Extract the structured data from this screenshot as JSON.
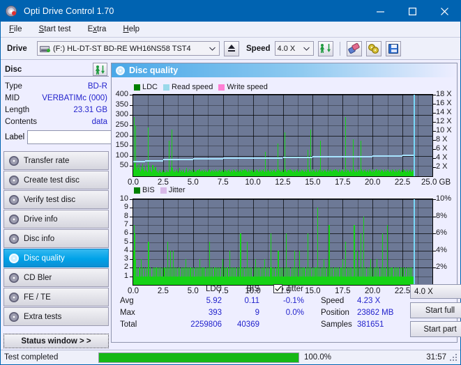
{
  "window": {
    "title": "Opti Drive Control 1.70",
    "icon": "disc-icon",
    "minimize": "minimize-icon",
    "maximize": "maximize-icon",
    "close": "close-icon"
  },
  "menu": {
    "items": [
      "File",
      "Start test",
      "Extra",
      "Help"
    ]
  },
  "toolbar": {
    "drive_label": "Drive",
    "drive_value": "(F:)  HL-DT-ST BD-RE  WH16NS58 TST4",
    "eject_icon": "eject-icon",
    "speed_label": "Speed",
    "speed_value": "4.0 X",
    "refresh_icon": "scan-refresh-icon",
    "erase_icon": "erase-icon",
    "discs_icon": "discs-icon",
    "save_icon": "save-icon"
  },
  "disc_panel": {
    "header": "Disc",
    "refresh_icon": "scan-refresh-icon",
    "rows": [
      {
        "key": "Type",
        "value": "BD-R"
      },
      {
        "key": "MID",
        "value": "VERBATIMc (000)"
      },
      {
        "key": "Length",
        "value": "23.31 GB"
      },
      {
        "key": "Contents",
        "value": "data"
      }
    ],
    "label_key": "Label",
    "label_value": "",
    "label_button_icon": "disc-icon"
  },
  "nav": {
    "items": [
      {
        "label": "Transfer rate",
        "icon": "disc-icon",
        "active": false
      },
      {
        "label": "Create test disc",
        "icon": "disc-icon",
        "active": false
      },
      {
        "label": "Verify test disc",
        "icon": "disc-icon",
        "active": false
      },
      {
        "label": "Drive info",
        "icon": "disc-icon",
        "active": false
      },
      {
        "label": "Disc info",
        "icon": "disc-icon",
        "active": false
      },
      {
        "label": "Disc quality",
        "icon": "disc-icon",
        "active": true
      },
      {
        "label": "CD Bler",
        "icon": "disc-icon",
        "active": false
      },
      {
        "label": "FE / TE",
        "icon": "disc-icon",
        "active": false
      },
      {
        "label": "Extra tests",
        "icon": "disc-icon",
        "active": false
      }
    ],
    "status_window": "Status window > >"
  },
  "content": {
    "header": "Disc quality",
    "header_icon": "disc-icon"
  },
  "stats": {
    "col_ldc": "LDC",
    "col_bis": "BIS",
    "rows": [
      {
        "key": "Avg",
        "ldc": "5.92",
        "bis": "0.11"
      },
      {
        "key": "Max",
        "ldc": "393",
        "bis": "9"
      },
      {
        "key": "Total",
        "ldc": "2259806",
        "bis": "40369"
      }
    ],
    "jitter_label": "Jitter",
    "jitter_checked": true,
    "jitter_values": [
      "-0.1%",
      "0.0%"
    ],
    "speed_key": "Speed",
    "speed_value": "4.23 X",
    "position_key": "Position",
    "position_value": "23862 MB",
    "samples_key": "Samples",
    "samples_value": "381651",
    "speed_select": "4.0 X",
    "start_full": "Start full",
    "start_part": "Start part"
  },
  "statusbar": {
    "text": "Test completed",
    "progress_label": "100.0%",
    "progress_value": 100,
    "time": "31:57"
  },
  "chart_data": [
    {
      "type": "bar",
      "name": "ldc-chart",
      "title": "",
      "xlabel": "GB",
      "ylabel": "",
      "ylim": [
        0,
        400
      ],
      "yticks": [
        50,
        100,
        150,
        200,
        250,
        300,
        350,
        400
      ],
      "y2lim": [
        0,
        18
      ],
      "y2ticks": [
        "2 X",
        "4 X",
        "6 X",
        "8 X",
        "10 X",
        "12 X",
        "14 X",
        "16 X",
        "18 X"
      ],
      "xlim": [
        0,
        25
      ],
      "xticks": [
        "0.0",
        "2.5",
        "5.0",
        "7.5",
        "10.0",
        "12.5",
        "15.0",
        "17.5",
        "20.0",
        "22.5",
        "25.0 GB"
      ],
      "grid": true,
      "legend": [
        {
          "label": "LDC",
          "color": "#008000"
        },
        {
          "label": "Read speed",
          "color": "#99d9ea"
        },
        {
          "label": "Write speed",
          "color": "#ff7fd4"
        }
      ],
      "series": [
        {
          "name": "LDC",
          "color": "#16d216",
          "values": [
            35,
            290,
            60,
            250,
            45,
            30,
            55,
            40,
            60,
            30,
            25,
            48,
            35,
            60,
            42,
            30,
            24,
            52,
            30,
            26,
            22,
            240,
            55,
            30,
            46,
            28,
            20,
            55,
            34,
            24,
            30,
            44,
            26,
            22,
            30,
            18,
            26,
            34,
            22,
            18,
            24,
            30,
            20,
            26,
            18,
            22,
            30,
            20,
            26,
            22,
            175,
            30,
            24,
            44,
            230,
            40,
            26,
            22,
            30,
            20,
            26,
            34,
            24,
            18,
            26,
            40,
            22,
            30,
            26,
            20,
            34,
            26,
            18,
            22,
            30,
            40,
            24,
            18,
            26,
            34,
            22,
            30,
            26,
            20,
            34,
            22,
            30,
            26,
            20,
            24,
            30,
            22,
            26,
            34,
            20,
            24,
            30,
            26,
            22,
            34,
            26,
            20,
            30,
            24,
            22,
            26,
            30,
            34,
            20,
            24,
            30,
            26,
            22,
            30,
            26,
            22,
            34,
            24,
            28,
            22,
            30,
            26,
            34,
            20,
            24,
            30,
            26,
            22,
            34,
            24,
            30,
            26,
            22,
            30,
            26,
            34,
            24,
            20,
            30,
            26,
            22,
            34,
            26,
            30,
            24,
            20,
            34,
            26,
            22,
            30,
            24,
            26,
            34,
            20,
            30,
            26,
            22,
            34,
            26,
            30,
            24,
            20,
            34,
            26,
            22,
            30,
            26,
            34,
            24,
            20,
            30,
            26,
            22,
            34,
            26,
            30,
            24,
            20,
            34,
            26,
            22,
            30,
            26,
            34,
            24,
            20,
            120,
            26,
            22,
            34,
            26,
            30,
            24,
            20,
            34,
            26,
            22,
            30,
            26,
            34,
            24,
            20,
            30,
            26,
            160,
            34,
            26,
            30,
            24,
            20,
            34,
            26,
            22,
            30,
            215,
            34,
            24,
            20,
            30,
            26,
            22,
            34,
            26,
            30,
            24,
            20,
            34,
            26,
            22,
            30,
            26,
            34,
            24,
            20,
            30,
            26,
            22,
            34,
            26,
            30,
            24,
            20,
            34,
            26,
            22,
            30,
            130,
            34,
            24,
            20,
            230,
            26,
            22,
            34,
            26,
            30,
            24,
            20,
            34,
            26,
            22,
            30,
            26,
            34,
            175,
            20,
            30,
            26,
            22,
            34,
            26,
            30,
            24,
            20,
            34,
            26,
            22,
            30,
            26,
            34,
            24,
            20,
            30,
            26,
            22,
            34,
            26,
            30,
            24,
            20,
            34,
            26,
            22,
            30,
            26,
            34,
            24,
            20,
            30,
            290,
            22,
            34,
            26,
            30,
            24,
            20,
            34,
            26,
            22,
            30,
            180,
            34,
            24,
            20,
            30,
            26,
            22,
            34,
            26,
            30,
            24,
            175,
            34,
            26,
            22,
            30,
            26,
            34,
            24,
            20,
            30,
            26,
            22,
            34,
            26,
            30,
            24,
            20,
            34,
            26,
            22,
            30,
            26,
            34,
            24,
            20,
            30,
            26,
            22,
            34,
            26,
            30,
            24,
            20,
            34,
            26,
            22,
            30,
            26,
            34,
            24,
            20,
            30,
            26,
            22,
            34,
            26,
            30,
            24,
            20,
            34,
            26,
            22,
            30,
            26,
            34,
            24,
            20,
            30,
            26,
            22,
            34,
            26,
            30,
            24,
            20,
            34,
            26,
            22,
            30,
            26,
            34,
            24,
            20,
            30,
            26,
            22
          ]
        },
        {
          "name": "Read speed",
          "color": "#a8e4ff",
          "points": [
            [
              0.0,
              3.4
            ],
            [
              1.0,
              3.6
            ],
            [
              2.5,
              3.8
            ],
            [
              5.0,
              4.0
            ],
            [
              7.5,
              4.1
            ],
            [
              10.0,
              4.2
            ],
            [
              12.5,
              4.3
            ],
            [
              15.0,
              4.4
            ],
            [
              17.5,
              4.5
            ],
            [
              20.0,
              4.6
            ],
            [
              22.5,
              4.7
            ],
            [
              23.4,
              4.8
            ]
          ]
        }
      ],
      "cursor_x": 23.4
    },
    {
      "type": "bar",
      "name": "bis-chart",
      "title": "",
      "xlabel": "GB",
      "ylabel": "",
      "ylim": [
        0,
        10
      ],
      "yticks": [
        1,
        2,
        3,
        4,
        5,
        6,
        7,
        8,
        9,
        10
      ],
      "y2lim": [
        0,
        10
      ],
      "y2ticks": [
        "2%",
        "4%",
        "6%",
        "8%",
        "10%"
      ],
      "xlim": [
        0,
        25
      ],
      "xticks": [
        "0.0",
        "2.5",
        "5.0",
        "7.5",
        "10.0",
        "12.5",
        "15.0",
        "17.5",
        "20.0",
        "22.5",
        "25.0 GB"
      ],
      "grid": true,
      "legend": [
        {
          "label": "BIS",
          "color": "#008000"
        },
        {
          "label": "Jitter",
          "color": "#d8b8e8"
        }
      ],
      "series": [
        {
          "name": "BIS",
          "color": "#16d216",
          "values": [
            4,
            7,
            6,
            3,
            1,
            2,
            1,
            1,
            2,
            1,
            3,
            1,
            2,
            1,
            1,
            2,
            1,
            1,
            2,
            1,
            5,
            5,
            1,
            2,
            1,
            1,
            2,
            1,
            2,
            1,
            2,
            2,
            1,
            2,
            1,
            2,
            1,
            2,
            1,
            1,
            2,
            1,
            2,
            1,
            2,
            1,
            5,
            1,
            2,
            1,
            4,
            1,
            2,
            1,
            4,
            1,
            2,
            1,
            2,
            1,
            2,
            1,
            2,
            1,
            1,
            2,
            1,
            2,
            1,
            2,
            1,
            3,
            1,
            2,
            1,
            2,
            1,
            2,
            1,
            2,
            1,
            2,
            1,
            1,
            2,
            1,
            2,
            1,
            2,
            1,
            3,
            1,
            2,
            1,
            2,
            1,
            2,
            1,
            1,
            2,
            1,
            2,
            1,
            5,
            1,
            2,
            1,
            2,
            1,
            1,
            2,
            1,
            2,
            1,
            2,
            1,
            2,
            1,
            1,
            2,
            1,
            3,
            1,
            2,
            1,
            2,
            1,
            2,
            1,
            1,
            4,
            1,
            2,
            1,
            2,
            1,
            2,
            1,
            2,
            1,
            1,
            2,
            1,
            2,
            1,
            6,
            1,
            2,
            1,
            2,
            1,
            1,
            2,
            1,
            5,
            1,
            2,
            1,
            2,
            1,
            2,
            1,
            1,
            2,
            1,
            3,
            1,
            2,
            1,
            2,
            1,
            2,
            1,
            1,
            2,
            1,
            2,
            1,
            3,
            1,
            2,
            1,
            2,
            1,
            1,
            2,
            6,
            2,
            1,
            2,
            1,
            2,
            1,
            1,
            2,
            1,
            4,
            1,
            2,
            1,
            2,
            1,
            2,
            1,
            1,
            2,
            1,
            6,
            1,
            2,
            1,
            2,
            1,
            1,
            2,
            1,
            2,
            1,
            4,
            1,
            2,
            1,
            2,
            1,
            1,
            4,
            1,
            2,
            1,
            2,
            1,
            2,
            1,
            1,
            2,
            1,
            6,
            1,
            2,
            1,
            2,
            1,
            1,
            2,
            1,
            2,
            1,
            2,
            1,
            9,
            1,
            2,
            1,
            1,
            2,
            1,
            2,
            1,
            3,
            1,
            2,
            1,
            1,
            2,
            1,
            7,
            1,
            2,
            1,
            2,
            1,
            1,
            2,
            1,
            2,
            1,
            2,
            1,
            2,
            1,
            1,
            2,
            1,
            3,
            1,
            2,
            1,
            5,
            1,
            1,
            2,
            1,
            2,
            1,
            2,
            1,
            2,
            1,
            1,
            7,
            1,
            2,
            1,
            4,
            1,
            2,
            1,
            1,
            6,
            1,
            2,
            1,
            8,
            1,
            2,
            1,
            1,
            2,
            1,
            2,
            1,
            3,
            1,
            2,
            1,
            1,
            2,
            1,
            2,
            1,
            3,
            1,
            2,
            1,
            1,
            2,
            1,
            6,
            1,
            2,
            1,
            2,
            1,
            1,
            7,
            1,
            2,
            1,
            2,
            1,
            2,
            1,
            1,
            2,
            1,
            2,
            1,
            2,
            1,
            2,
            1,
            1,
            2,
            1,
            2,
            1,
            2,
            1,
            2,
            1,
            1,
            2,
            1,
            2,
            1,
            2,
            1,
            2,
            1,
            1,
            2
          ]
        }
      ],
      "cursor_x": 23.4
    }
  ]
}
